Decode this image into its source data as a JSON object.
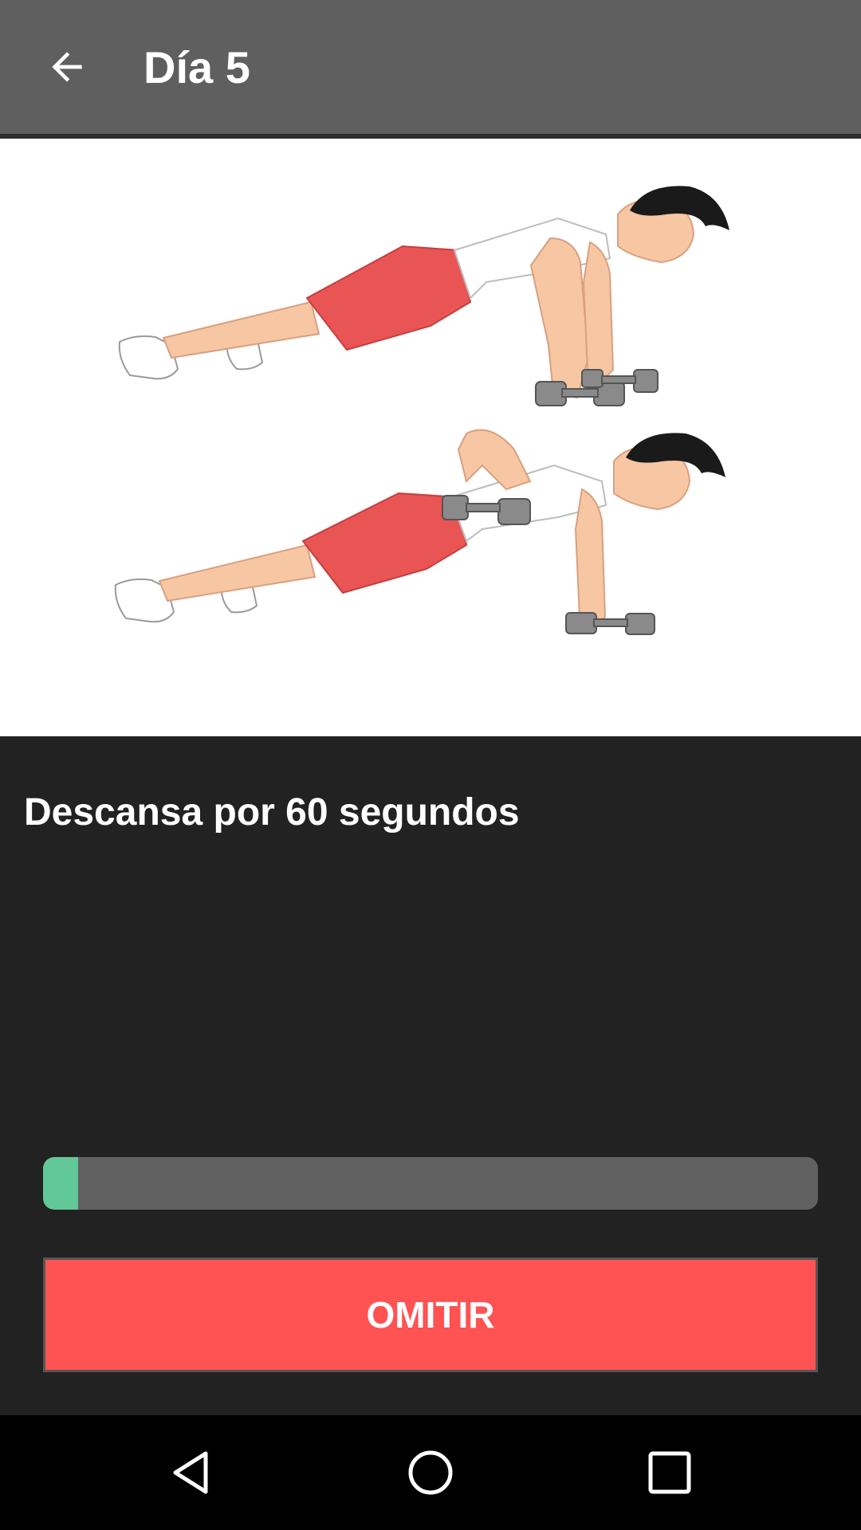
{
  "app_bar": {
    "title": "Día 5",
    "back_icon": "arrow-back-icon",
    "background": "#5f5f5f"
  },
  "illustration": {
    "description_icon": "exercise-illustration",
    "background": "#ffffff"
  },
  "rest": {
    "message": "Descansa por 60 segundos"
  },
  "progress": {
    "fraction": 0.045,
    "track_color": "#616161",
    "fill_color": "#62c897"
  },
  "skip_button": {
    "label": "OMITIR",
    "color": "#ff5252"
  },
  "nav_bar": {
    "back_icon": "nav-back-icon",
    "home_icon": "nav-home-icon",
    "recents_icon": "nav-recents-icon"
  }
}
